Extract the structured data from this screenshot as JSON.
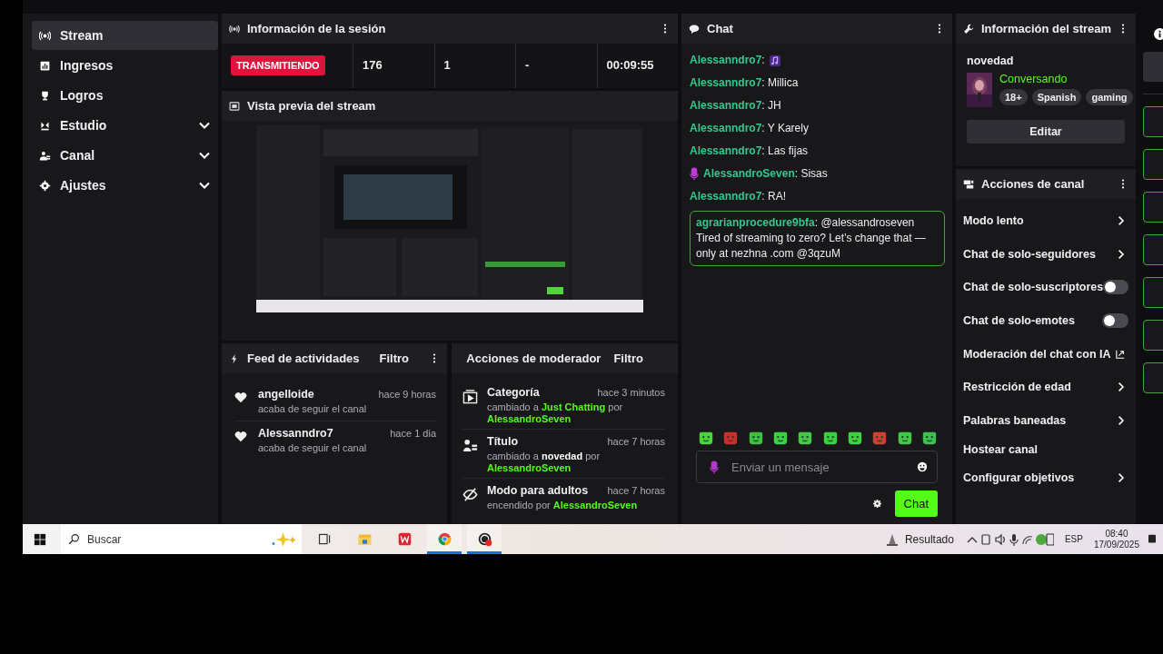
{
  "sidebar": {
    "items": [
      {
        "label": "Stream",
        "selected": true,
        "expandable": false
      },
      {
        "label": "Ingresos",
        "selected": false,
        "expandable": false
      },
      {
        "label": "Logros",
        "selected": false,
        "expandable": false
      },
      {
        "label": "Estudio",
        "selected": false,
        "expandable": true
      },
      {
        "label": "Canal",
        "selected": false,
        "expandable": true
      },
      {
        "label": "Ajustes",
        "selected": false,
        "expandable": true
      }
    ]
  },
  "session": {
    "title": "Información de la sesión",
    "status": "TRANSMITIENDO",
    "stats": [
      "176",
      "1",
      "-",
      "00:09:55"
    ]
  },
  "preview": {
    "title": "Vista previa del stream"
  },
  "feed": {
    "title": "Feed de actividades",
    "filter": "Filtro",
    "items": [
      {
        "user": "angelloide",
        "time": "hace 9 horas",
        "text": "acaba de seguir el canal"
      },
      {
        "user": "Alessanndro7",
        "time": "hace 1 dia",
        "text": "acaba de seguir el canal"
      }
    ]
  },
  "mod_actions": {
    "title": "Acciones de moderador",
    "filter": "Filtro",
    "items": [
      {
        "title": "Categoría",
        "time": "hace 3 minutos",
        "parts": [
          {
            "text": "cambiado a ",
            "kind": "plain"
          },
          {
            "text": "Just Chatting",
            "kind": "green"
          },
          {
            "text": " por ",
            "kind": "plain"
          },
          {
            "text": "AlessandroSeven",
            "kind": "green"
          }
        ]
      },
      {
        "title": "Título",
        "time": "hace 7 horas",
        "parts": [
          {
            "text": "cambiado a ",
            "kind": "plain"
          },
          {
            "text": "novedad",
            "kind": "bold"
          },
          {
            "text": " por ",
            "kind": "plain"
          },
          {
            "text": "AlessandroSeven",
            "kind": "green"
          }
        ]
      },
      {
        "title": "Modo para adultos",
        "time": "hace 7 horas",
        "parts": [
          {
            "text": "encendido por ",
            "kind": "plain"
          },
          {
            "text": "AlessandroSeven",
            "kind": "green"
          }
        ]
      }
    ]
  },
  "chat": {
    "title": "Chat",
    "messages": [
      {
        "kind": "emote",
        "user": "Alessanndro7",
        "text": ":"
      },
      {
        "kind": "plain",
        "user": "Alessanndro7",
        "text": ": Millica"
      },
      {
        "kind": "plain",
        "user": "Alessanndro7",
        "text": ": JH"
      },
      {
        "kind": "plain",
        "user": "Alessanndro7",
        "text": ": Y Karely"
      },
      {
        "kind": "plain",
        "user": "Alessanndro7",
        "text": ": Las fijas"
      },
      {
        "kind": "badge",
        "user": "AlessandroSeven",
        "text": ": Sisas"
      },
      {
        "kind": "plain",
        "user": "Alessanndro7",
        "text": ": RA!"
      },
      {
        "kind": "highlight",
        "user": "agrarianprocedure9bfa",
        "text": ": @alessandroseven Tired of streaming to zero? Let’s change that — only at nezhna .com @3qzuM"
      }
    ],
    "placeholder": "Enviar un mensaje",
    "send": "Chat"
  },
  "stream_info": {
    "title": "Información del stream",
    "stream_title": "novedad",
    "category": "Conversando",
    "tags": [
      "18+",
      "Spanish",
      "gaming"
    ],
    "edit": "Editar"
  },
  "channel_actions": {
    "title": "Acciones de canal",
    "items": [
      {
        "label": "Modo lento",
        "kind": "arrow"
      },
      {
        "label": "Chat de solo-seguidores",
        "kind": "arrow"
      },
      {
        "label": "Chat de solo-suscriptores",
        "kind": "toggle",
        "on": false
      },
      {
        "label": "Chat de solo-emotes",
        "kind": "toggle",
        "on": false
      },
      {
        "label": "Moderación del chat con IA",
        "kind": "external"
      },
      {
        "label": "Restricción de edad",
        "kind": "arrow"
      },
      {
        "label": "Palabras baneadas",
        "kind": "arrow"
      },
      {
        "label": "Hostear canal",
        "kind": "plain"
      },
      {
        "label": "Configurar objetivos",
        "kind": "arrow"
      }
    ]
  },
  "taskbar": {
    "search": "Buscar",
    "apps": [
      {
        "kind": "taskview",
        "active": false
      },
      {
        "kind": "files",
        "active": false
      },
      {
        "kind": "wps",
        "active": false
      },
      {
        "kind": "chrome",
        "active": true
      },
      {
        "kind": "obs",
        "active": true
      }
    ],
    "weather": "Resultado",
    "language": "ESP",
    "time": "08:40",
    "date": "17/09/2025"
  }
}
